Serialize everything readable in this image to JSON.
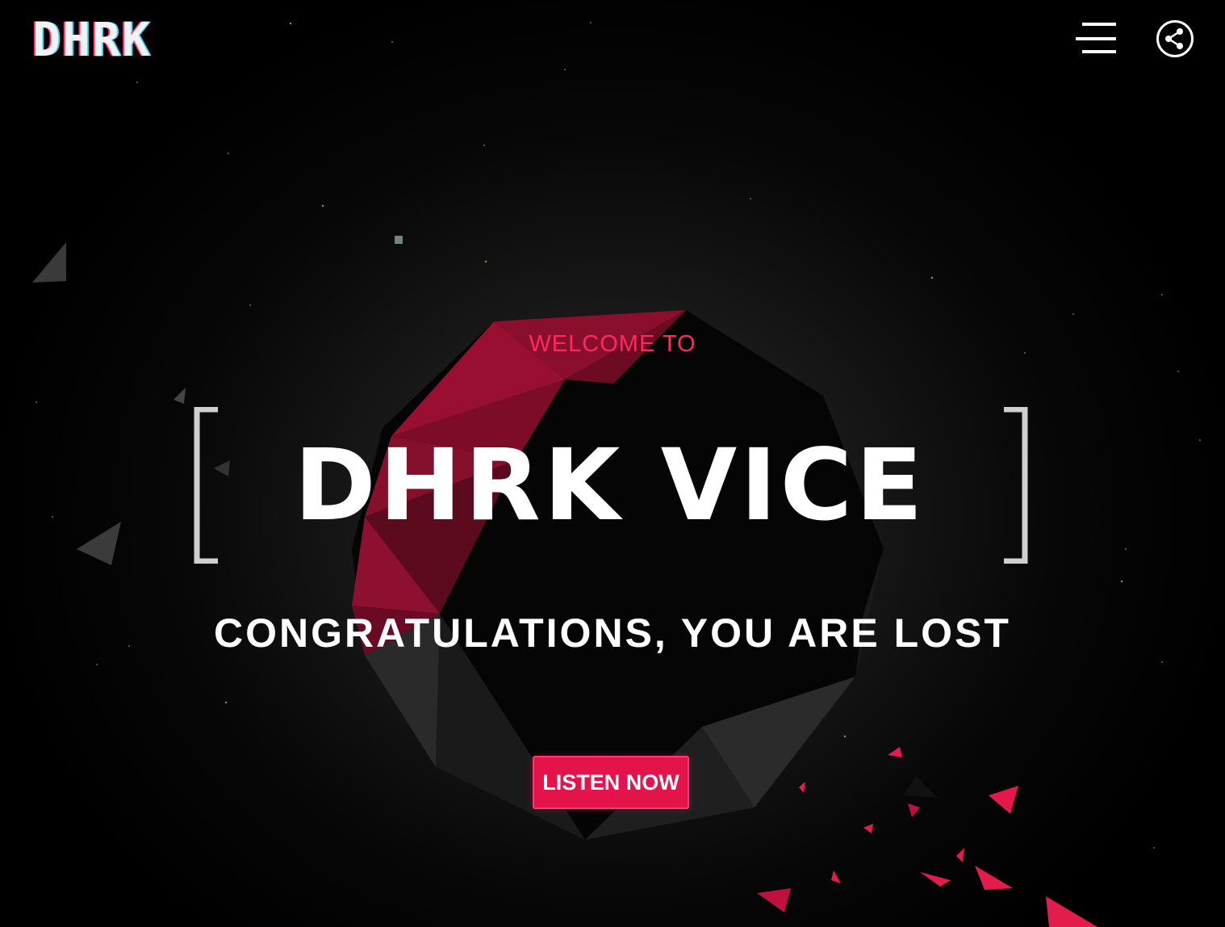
{
  "header": {
    "logo_text": "DHRK",
    "menu_icon": "hamburger-menu-icon",
    "share_icon": "share-icon"
  },
  "hero": {
    "welcome": "WELCOME TO",
    "title": "DHRK VICE",
    "tagline": "CONGRATULATIONS, YOU ARE LOST",
    "cta_label": "LISTEN NOW"
  },
  "colors": {
    "accent": "#e4144b",
    "welcome_text": "#ff2860",
    "background": "#000000",
    "polyhedron_red": "#8a0f2c"
  }
}
